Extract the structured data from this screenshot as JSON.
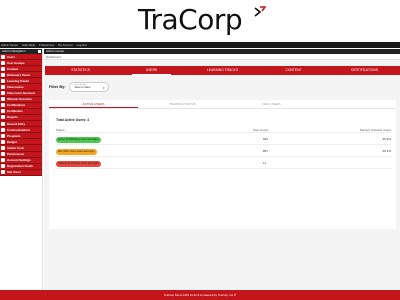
{
  "brand": {
    "logo_text": "TraCorp",
    "accent": "#c3161c",
    "dark": "#1a1a1a"
  },
  "topnav": {
    "items": [
      "Admin Center",
      "Help Desk",
      "Preferences",
      "My Account",
      "Log Out"
    ]
  },
  "sidebar": {
    "header": "Admin Navigation",
    "items": [
      {
        "label": "Users",
        "icon": "users-icon"
      },
      {
        "label": "User Groups",
        "icon": "user-groups-icon"
      },
      {
        "label": "Content",
        "icon": "content-icon"
      },
      {
        "label": "Dictionary Terms",
        "icon": "dictionary-icon"
      },
      {
        "label": "Learning Tracks",
        "icon": "learning-tracks-icon"
      },
      {
        "label": "Classrooms",
        "icon": "classrooms-icon"
      },
      {
        "label": "Classroom Sessions",
        "icon": "classroom-sessions-icon"
      },
      {
        "label": "Webinar Sessions",
        "icon": "webinar-icon"
      },
      {
        "label": "Certifications",
        "icon": "certifications-icon"
      },
      {
        "label": "Certificates",
        "icon": "certificates-icon"
      },
      {
        "label": "Reports",
        "icon": "reports-icon"
      },
      {
        "label": "Record Entry",
        "icon": "record-entry-icon"
      },
      {
        "label": "Communications",
        "icon": "communications-icon"
      },
      {
        "label": "Programs",
        "icon": "programs-icon"
      },
      {
        "label": "Badges",
        "icon": "badges-icon"
      },
      {
        "label": "Admin Tools",
        "icon": "admin-tools-icon"
      },
      {
        "label": "Permissions",
        "icon": "permissions-icon"
      },
      {
        "label": "Account Settings",
        "icon": "account-settings-icon"
      },
      {
        "label": "Registration Fields",
        "icon": "registration-fields-icon"
      },
      {
        "label": "Site Tours",
        "icon": "site-tours-icon"
      }
    ]
  },
  "main": {
    "top_label": "Admin Center",
    "breadcrumb": "Dashboard",
    "tabs": [
      {
        "label": "STATISTICS",
        "active": false
      },
      {
        "label": "USERS",
        "active": true
      },
      {
        "label": "LEARNING TRACKS",
        "active": false
      },
      {
        "label": "CONTENT",
        "active": false
      },
      {
        "label": "CERTIFICATIONS",
        "active": false
      }
    ],
    "filter": {
      "label": "Filter By:",
      "select_caption": "User Group",
      "select_value": "Select a Value"
    },
    "subtabs": [
      {
        "label": "ACTIVE USERS",
        "active": true
      },
      {
        "label": "TRAINING STATUS",
        "active": false
      },
      {
        "label": "NEW USERS",
        "active": false
      }
    ],
    "total_label": "Total Active Users: 4",
    "columns": {
      "status": "Status",
      "count": "User Count",
      "percent": "Percent of Active Users"
    },
    "rows": [
      {
        "status": "Active (0-180 Days since last login)",
        "count": "592",
        "percent": "35.9%",
        "color": "#4cc94c"
      },
      {
        "status": "Idle (181+ Days since last login)",
        "count": "867",
        "percent": "60.4%",
        "color": "#f5a623"
      },
      {
        "status": "Inactive (0-90 Days since last login)",
        "count": "11",
        "percent": "",
        "color": "#e8453c"
      }
    ]
  },
  "footer": {
    "text": "TraCorp Demo LMS 10.22.3 is powered by TraCorp, Inc.®"
  }
}
